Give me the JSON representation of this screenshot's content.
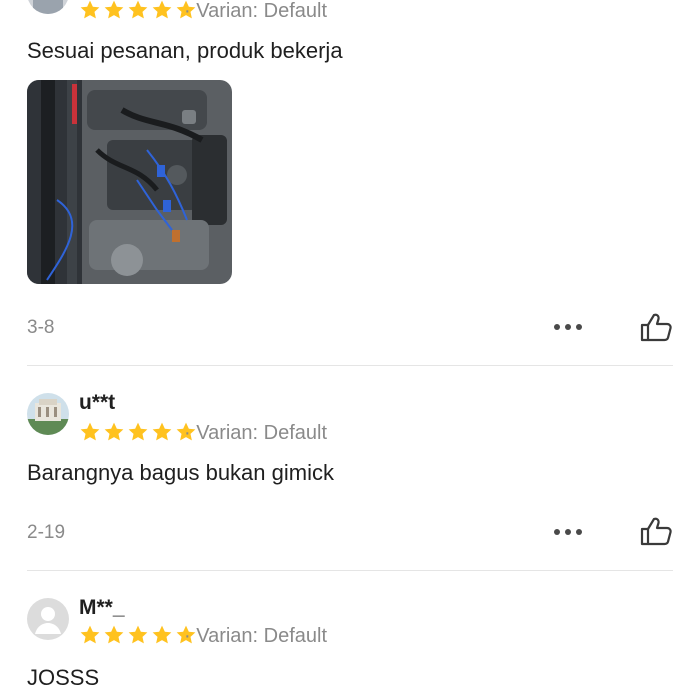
{
  "reviews": [
    {
      "variant": "· Varian: Default",
      "rating": 5,
      "comment": "Sesuai pesanan, produk bekerja",
      "date": "3-8",
      "photo_icon": "engine-photo"
    },
    {
      "username": "u**t",
      "variant": "· Varian: Default",
      "rating": 5,
      "comment": "Barangnya bagus bukan gimick",
      "date": "2-19"
    },
    {
      "username": "M**_",
      "variant": "· Varian: Default",
      "rating": 5,
      "comment": "JOSSS"
    }
  ],
  "colors": {
    "star": "#FFC21F",
    "muted_text": "#8a8a8a",
    "divider": "#e5e5e5"
  },
  "icons": {
    "more": "more-options-icon",
    "like": "thumbs-up-icon",
    "avatar_default": "default-avatar-icon"
  }
}
